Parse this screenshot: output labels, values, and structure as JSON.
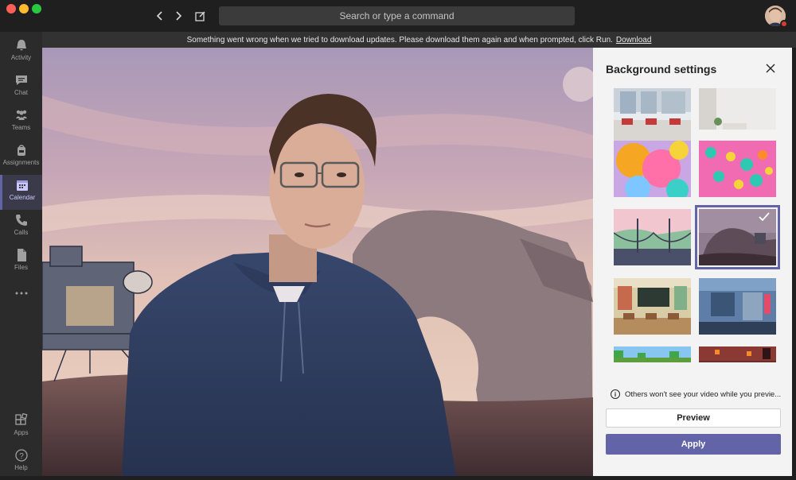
{
  "search": {
    "placeholder": "Search or type a command"
  },
  "banner": {
    "message": "Something went wrong when we tried to download updates. Please download them again and when prompted, click Run.",
    "link": "Download"
  },
  "rail": {
    "items": [
      {
        "label": "Activity",
        "icon": "bell-icon"
      },
      {
        "label": "Chat",
        "icon": "chat-icon"
      },
      {
        "label": "Teams",
        "icon": "teams-icon"
      },
      {
        "label": "Assignments",
        "icon": "backpack-icon"
      },
      {
        "label": "Calendar",
        "icon": "calendar-icon",
        "active": true
      },
      {
        "label": "Calls",
        "icon": "phone-icon"
      },
      {
        "label": "Files",
        "icon": "file-icon"
      },
      {
        "label": "...",
        "icon": "more-icon"
      },
      {
        "label": "Apps",
        "icon": "apps-icon"
      },
      {
        "label": "Help",
        "icon": "help-icon"
      }
    ]
  },
  "panel": {
    "title": "Background settings",
    "info": "Others won't see your video while you previe...",
    "preview_label": "Preview",
    "apply_label": "Apply",
    "selected_background": "space-landscape"
  },
  "colors": {
    "accent": "#6264a7",
    "rail": "#2b2b2b",
    "titlebar": "#1f1f1f"
  }
}
